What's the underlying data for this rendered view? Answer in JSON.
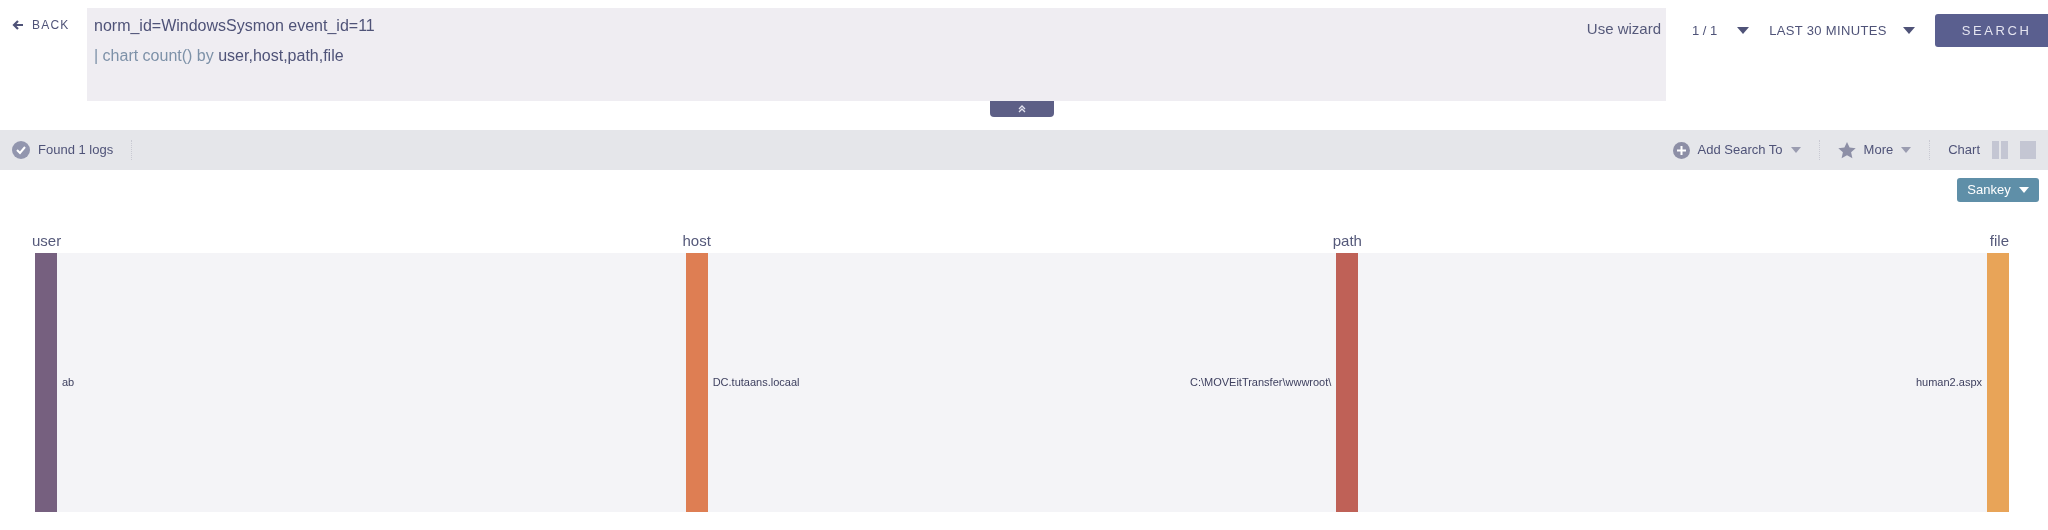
{
  "back": {
    "label": "BACK"
  },
  "query": {
    "lines": [
      [
        {
          "kind": "field",
          "text": "norm_id=WindowsSysmon event_id=11"
        }
      ],
      [
        {
          "kind": "keyword",
          "text": "| chart count() by"
        },
        {
          "kind": "field",
          "text": "user,host,path,file"
        }
      ]
    ],
    "wizard": "Use wizard"
  },
  "page_selector": "1 / 1",
  "time_range": "LAST 30 MINUTES",
  "search_button": "SEARCH",
  "toolbar": {
    "status": "Found 1 logs",
    "add_search": "Add Search To",
    "more": "More",
    "chart_label": "Chart"
  },
  "chart_type": "Sankey",
  "sankey": {
    "columns": [
      {
        "label": "user",
        "nodes": [
          {
            "label": "ab",
            "color": "#76607f"
          }
        ]
      },
      {
        "label": "host",
        "nodes": [
          {
            "label": "DC.tutaans.locaal",
            "color": "#de7e53"
          }
        ]
      },
      {
        "label": "path",
        "nodes": [
          {
            "label": "C:\\MOVEitTransfer\\wwwroot\\",
            "color": "#bf6157"
          }
        ]
      },
      {
        "label": "file",
        "nodes": [
          {
            "label": "human2.aspx",
            "color": "#e8a458"
          }
        ]
      }
    ]
  }
}
